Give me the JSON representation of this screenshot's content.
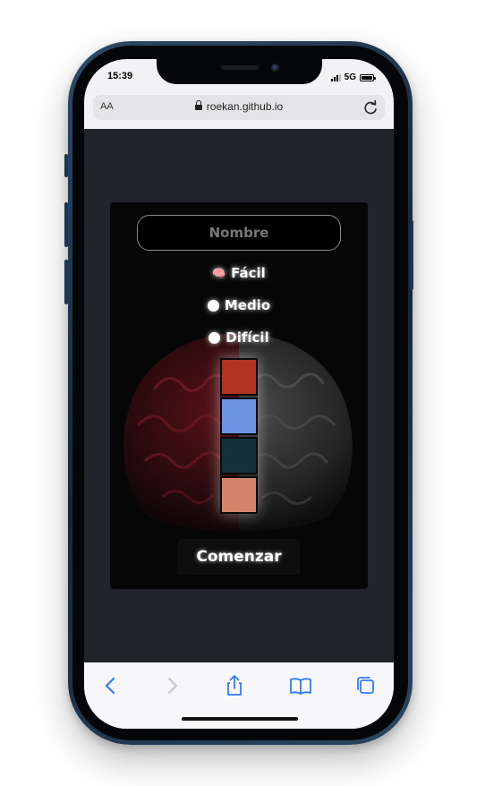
{
  "status_bar": {
    "time": "15:39",
    "network": "5G"
  },
  "browser": {
    "text_size_label": "AA",
    "url": "roekan.github.io",
    "toolbar": [
      "back-icon",
      "forward-icon",
      "share-icon",
      "bookmarks-icon",
      "tabs-icon"
    ]
  },
  "game": {
    "name_placeholder": "Nombre",
    "difficulty": {
      "selected": "Fácil",
      "options": [
        "Fácil",
        "Medio",
        "Difícil"
      ]
    },
    "color_sequence": [
      "#b03421",
      "#6a93e1",
      "#133138",
      "#d3856a"
    ],
    "start_label": "Comenzar"
  },
  "colors": {
    "page_background": "#212429",
    "card_background": "#060606",
    "phone_frame": "#1d3650"
  }
}
